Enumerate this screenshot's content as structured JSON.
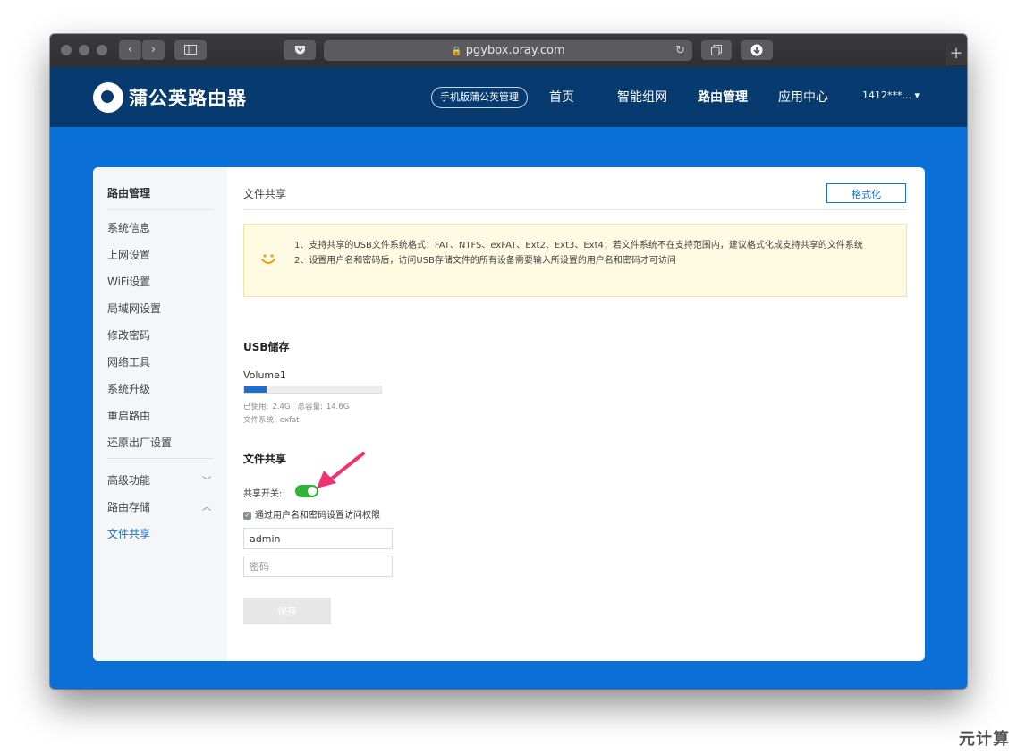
{
  "browser": {
    "url": "pgybox.oray.com"
  },
  "header": {
    "logo_text": "蒲公英路由器",
    "mobile_btn": "手机版蒲公英管理",
    "nav": [
      "首页",
      "智能组网",
      "路由管理",
      "应用中心"
    ],
    "user": "1412***... ▾"
  },
  "sidebar": {
    "title": "路由管理",
    "items": [
      "系统信息",
      "上网设置",
      "WiFi设置",
      "局域网设置",
      "修改密码",
      "网络工具",
      "系统升级",
      "重启路由",
      "还原出厂设置"
    ],
    "groups": [
      "高级功能",
      "路由存储"
    ],
    "active": "文件共享"
  },
  "main": {
    "page_title": "文件共享",
    "format_btn": "格式化",
    "notice": {
      "line1": "1、支持共享的USB文件系统格式：FAT、NTFS、exFAT、Ext2、Ext3、Ext4；若文件系统不在支持范围内，建议格式化成支持共享的文件系统",
      "line2": "2、设置用户名和密码后，访问USB存储文件的所有设备需要输入所设置的用户名和密码才可访问"
    },
    "usb": {
      "title": "USB储存",
      "volume": "Volume1",
      "used_fraction": 0.164,
      "used_label": "已使用:",
      "used_value": "2.4G",
      "total_label": "总容量:",
      "total_value": "14.6G",
      "fs_label": "文件系统:",
      "fs_value": "exfat"
    },
    "share": {
      "title": "文件共享",
      "switch_label": "共享开关:",
      "switch_on": true,
      "auth_label": "通过用户名和密码设置访问权限",
      "username": "admin",
      "password_placeholder": "密码",
      "save": "保存"
    }
  },
  "watermark": "元计算",
  "colors": {
    "header_bg": "#073a6e",
    "page_bg": "#0a6fd6",
    "accent": "#1a6fd1",
    "toggle_on": "#2fb536",
    "arrow": "#f0336e"
  }
}
